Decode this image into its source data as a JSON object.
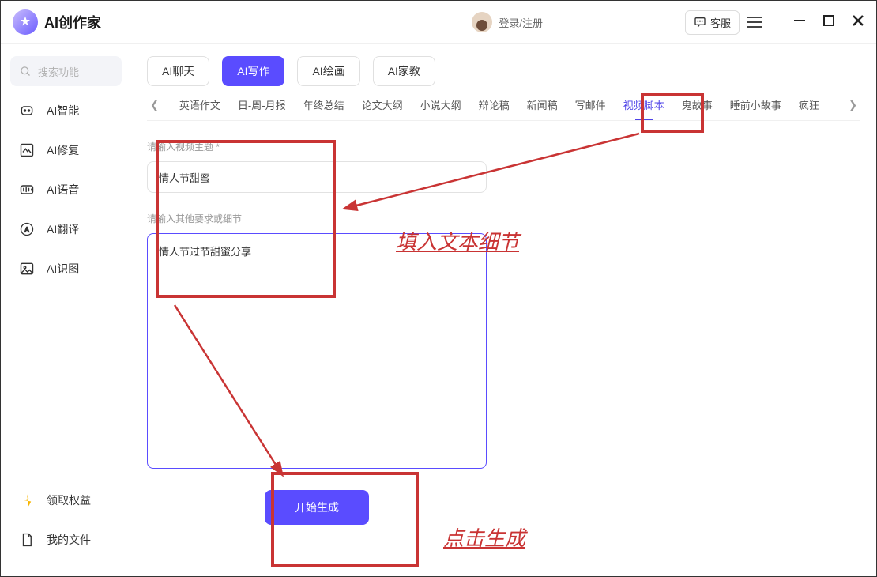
{
  "header": {
    "app_name": "AI创作家",
    "login_text": "登录/注册",
    "kefu_label": "客服"
  },
  "search": {
    "placeholder": "搜索功能"
  },
  "sidebar": {
    "items": [
      {
        "label": "AI智能"
      },
      {
        "label": "AI修复"
      },
      {
        "label": "AI语音"
      },
      {
        "label": "AI翻译"
      },
      {
        "label": "AI识图"
      }
    ],
    "bottom": [
      {
        "label": "领取权益"
      },
      {
        "label": "我的文件"
      }
    ]
  },
  "tabs": [
    {
      "label": "AI聊天"
    },
    {
      "label": "AI写作"
    },
    {
      "label": "AI绘画"
    },
    {
      "label": "AI家教"
    }
  ],
  "subnav": [
    "英语作文",
    "日-周-月报",
    "年终总结",
    "论文大纲",
    "小说大纲",
    "辩论稿",
    "新闻稿",
    "写邮件",
    "视频脚本",
    "鬼故事",
    "睡前小故事",
    "疯狂"
  ],
  "form": {
    "label1": "请输入视频主题 *",
    "input1": "情人节甜蜜",
    "label2": "请输入其他要求或细节",
    "textarea": "情人节过节甜蜜分享",
    "button": "开始生成"
  },
  "annotations": {
    "text1": "填入文本细节",
    "text2": "点击生成"
  }
}
